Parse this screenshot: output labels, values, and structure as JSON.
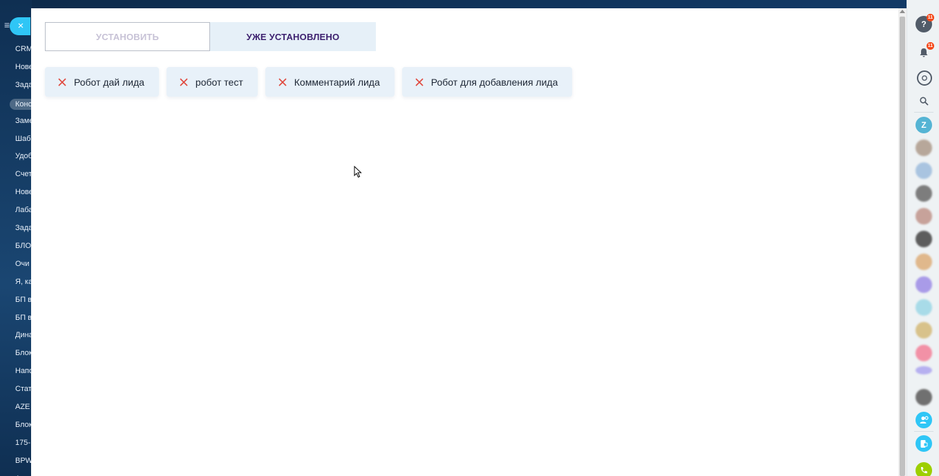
{
  "background_menu": {
    "items": [
      "CRM",
      "Нове",
      "Зада",
      "Конс",
      "Заме",
      "Шаб",
      "Удоб",
      "Счет",
      "Нове",
      "Лаба",
      "Зада",
      "БЛО",
      "Очи",
      "Я, ка",
      "БП в",
      "БП в",
      "Дина",
      "Блок",
      "Напо",
      "Стат",
      "AZE",
      "Блок",
      "175-",
      "BPW",
      "Ан"
    ],
    "active_index": 3
  },
  "close_label": "×",
  "tabs": {
    "install": "УСТАНОВИТЬ",
    "installed": "УЖЕ УСТАНОВЛЕНО"
  },
  "chips": [
    {
      "label": "Робот дай лида"
    },
    {
      "label": "робот тест"
    },
    {
      "label": "Комментарий лида"
    },
    {
      "label": "Робот для добавления лида"
    }
  ],
  "right_bar": {
    "help_badge": "11",
    "notifications_badge": "11",
    "user_initial": "Z"
  },
  "colors": {
    "accent": "#2fc6f6",
    "remove_x": "#e0473d",
    "chip_bg": "#e8f1f9",
    "tab_active_text": "#3c1f6e"
  }
}
